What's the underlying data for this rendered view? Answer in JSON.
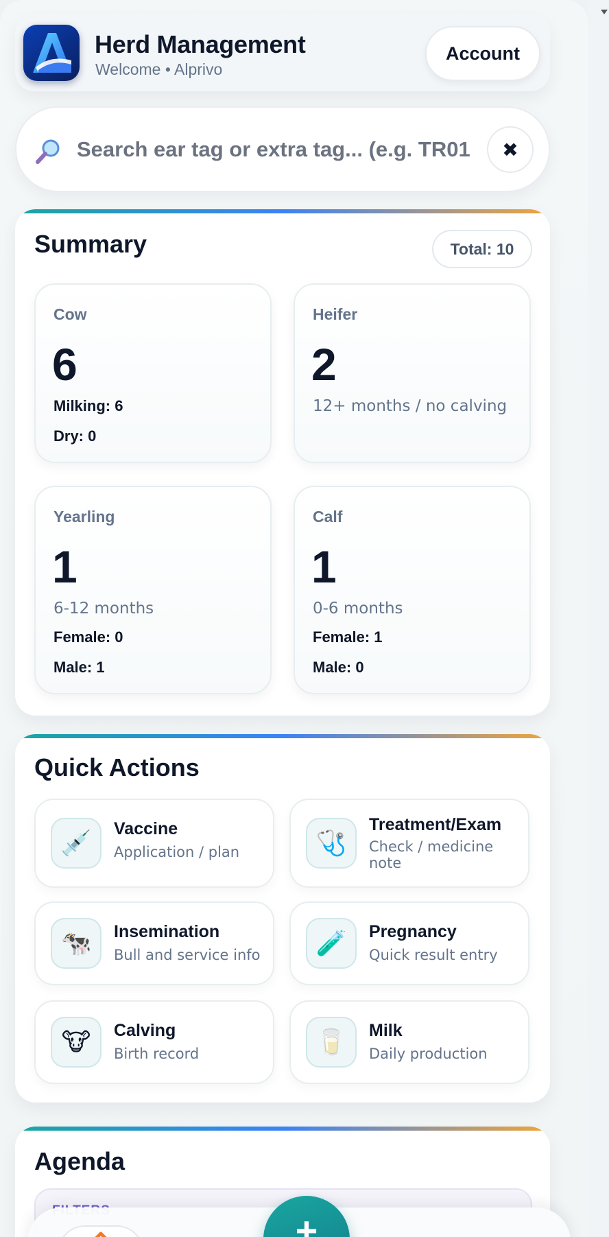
{
  "header": {
    "title": "Herd Management",
    "subtitle": "Welcome • Alprivo",
    "account_label": "Account"
  },
  "search": {
    "placeholder": "Search ear tag or extra tag... (e.g. TR01",
    "clear_symbol": "✖"
  },
  "summary": {
    "title": "Summary",
    "total_label": "Total: 10",
    "cards": {
      "cow": {
        "label": "Cow",
        "value": "6",
        "line1": "Milking: 6",
        "line2": "Dry: 0"
      },
      "heifer": {
        "label": "Heifer",
        "value": "2",
        "note": "12+ months / no calving"
      },
      "yearling": {
        "label": "Yearling",
        "value": "1",
        "note": "6-12 months",
        "line1": "Female: 0",
        "line2": "Male: 1"
      },
      "calf": {
        "label": "Calf",
        "value": "1",
        "note": "0-6 months",
        "line1": "Female: 1",
        "line2": "Male: 0"
      }
    }
  },
  "quick_actions": {
    "title": "Quick Actions",
    "items": [
      {
        "title": "Vaccine",
        "desc": "Application / plan",
        "icon": "💉",
        "icon_name": "syringe-icon"
      },
      {
        "title": "Treatment/Exam",
        "desc": "Check / medicine note",
        "icon": "🩺",
        "icon_name": "stethoscope-icon"
      },
      {
        "title": "Insemination",
        "desc": "Bull and service info",
        "icon": "🐄",
        "icon_name": "cow-icon"
      },
      {
        "title": "Pregnancy",
        "desc": "Quick result entry",
        "icon": "🧪",
        "icon_name": "test-tube-icon"
      },
      {
        "title": "Calving",
        "desc": "Birth record",
        "icon": "🐮",
        "icon_name": "cow-face-icon"
      },
      {
        "title": "Milk",
        "desc": "Daily production",
        "icon": "🥛",
        "icon_name": "milk-glass-icon"
      }
    ]
  },
  "agenda": {
    "title": "Agenda",
    "filters_label": "FILTERS"
  },
  "nav": {
    "fab_symbol": "+",
    "home_icon_name": "home-icon"
  },
  "colors": {
    "accent_teal": "#1aa6a0",
    "accent_blue": "#3b82f6",
    "accent_orange": "#f0a53a",
    "text_primary": "#0f172a",
    "text_muted": "#64748b"
  }
}
